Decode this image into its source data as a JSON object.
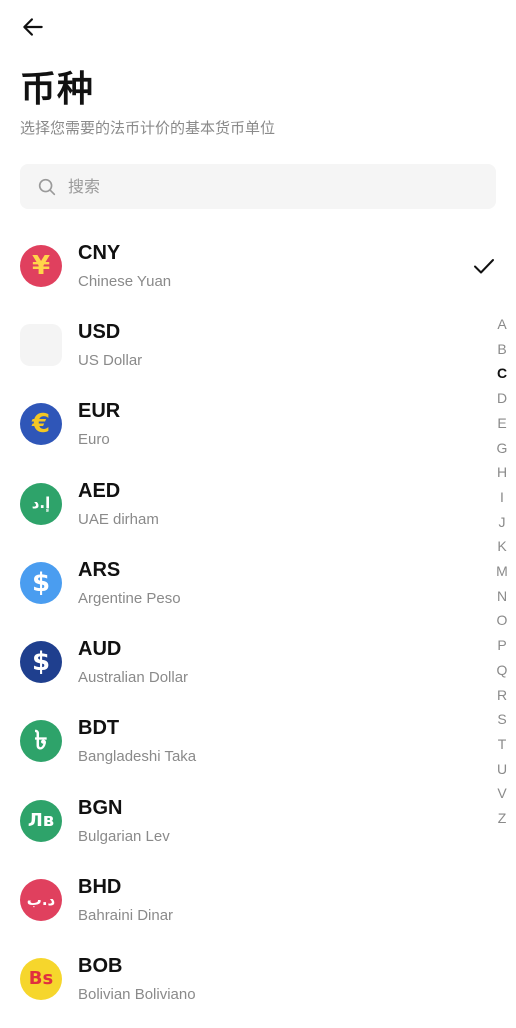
{
  "header": {
    "title": "币种",
    "subtitle": "选择您需要的法币计价的基本货币单位"
  },
  "search": {
    "placeholder": "搜索"
  },
  "selected_code": "CNY",
  "currencies": [
    {
      "code": "CNY",
      "name": "Chinese Yuan",
      "symbol": "¥",
      "bg": "#e0405e",
      "fg": "#ffd54a",
      "icon": "yuan-coin-icon"
    },
    {
      "code": "USD",
      "name": "US Dollar",
      "symbol": "",
      "bg": "#f4f4f4",
      "fg": "#f4f4f4",
      "icon": "blank-icon"
    },
    {
      "code": "EUR",
      "name": "Euro",
      "symbol": "€",
      "bg": "#2f56b8",
      "fg": "#f3c623",
      "icon": "euro-coin-icon"
    },
    {
      "code": "AED",
      "name": "UAE dirham",
      "symbol": "إ.د",
      "bg": "#2ea36a",
      "fg": "#ffffff",
      "icon": "dirham-coin-icon"
    },
    {
      "code": "ARS",
      "name": "Argentine Peso",
      "symbol": "$",
      "bg": "#4a9df0",
      "fg": "#ffffff",
      "icon": "peso-coin-icon"
    },
    {
      "code": "AUD",
      "name": "Australian Dollar",
      "symbol": "$",
      "bg": "#1f3f8e",
      "fg": "#ffffff",
      "icon": "dollar-coin-icon"
    },
    {
      "code": "BDT",
      "name": "Bangladeshi Taka",
      "symbol": "৳",
      "bg": "#2ea36a",
      "fg": "#ffffff",
      "icon": "taka-coin-icon"
    },
    {
      "code": "BGN",
      "name": "Bulgarian Lev",
      "symbol": "Лв",
      "bg": "#2ea36a",
      "fg": "#ffffff",
      "icon": "lev-coin-icon"
    },
    {
      "code": "BHD",
      "name": "Bahraini Dinar",
      "symbol": "د.ب",
      "bg": "#e0405e",
      "fg": "#ffffff",
      "icon": "dinar-coin-icon"
    },
    {
      "code": "BOB",
      "name": "Bolivian Boliviano",
      "symbol": "Bs",
      "bg": "#f6d62c",
      "fg": "#e0303e",
      "icon": "boliviano-coin-icon"
    }
  ],
  "alphabet": [
    "A",
    "B",
    "C",
    "D",
    "E",
    "G",
    "H",
    "I",
    "J",
    "K",
    "M",
    "N",
    "O",
    "P",
    "Q",
    "R",
    "S",
    "T",
    "U",
    "V",
    "Z"
  ],
  "active_letter": "C"
}
